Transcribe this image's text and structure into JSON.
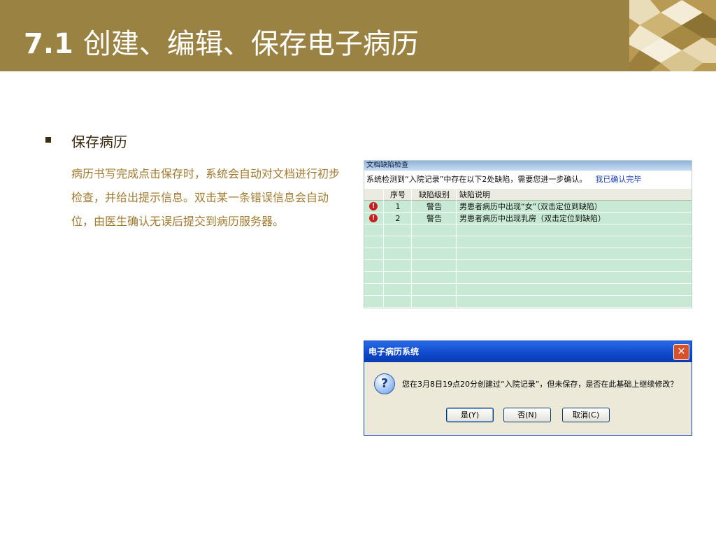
{
  "header": {
    "number": "7.1",
    "title": "创建、编辑、保存电子病历"
  },
  "section": {
    "title": "保存病历",
    "paragraph": "病历书写完成点击保存时，系统会自动对文档进行初步检查，并给出提示信息。双击某一条错误信息会自动位，由医生确认无误后提交到病历服务器。"
  },
  "defect_panel": {
    "title": "文档缺陷检查",
    "message": "系统检测到“入院记录”中存在以下2处缺陷，需要您进一步确认。",
    "confirm_link": "我已确认完毕",
    "columns": [
      "序号",
      "缺陷级别",
      "缺陷说明"
    ],
    "rows": [
      {
        "index": "1",
        "level": "警告",
        "desc": "男患者病历中出现“女”（双击定位到缺陷）"
      },
      {
        "index": "2",
        "level": "警告",
        "desc": "男患者病历中出现乳房（双击定位到缺陷）"
      }
    ]
  },
  "dialog": {
    "title": "电子病历系统",
    "message": "您在3月8日19点20分创建过“入院记录”，但未保存，是否在此基础上继续修改？",
    "yes_label": "是(Y)",
    "no_label": "否(N)",
    "cancel_label": "取消(C)"
  },
  "colors": {
    "header_bg": "#9a8243",
    "paragraph_text": "#a17b2f",
    "grid_bg": "#c8ead4",
    "dialog_title": "#0e48c9"
  }
}
